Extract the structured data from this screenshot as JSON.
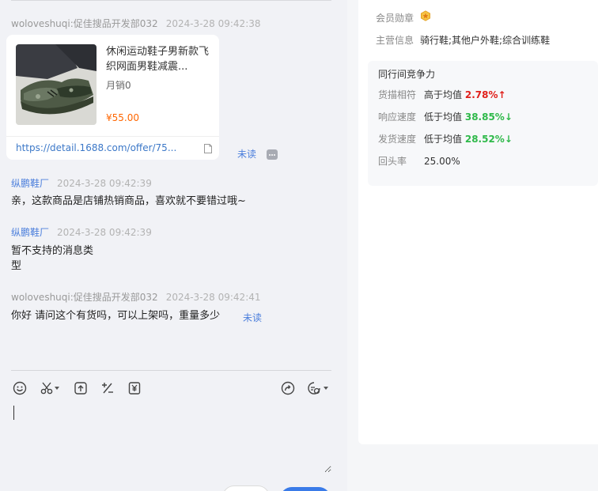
{
  "chat": {
    "messages": [
      {
        "sender": "woloveshuqi:促佳搜品开发部032",
        "time": "2024-3-28 09:42:38",
        "type": "product"
      },
      {
        "sender": "纵鹏鞋厂",
        "time": "2024-3-28 09:42:39",
        "text": "亲，这款商品是店铺热销商品，喜欢就不要错过哦~"
      },
      {
        "sender": "纵鹏鞋厂",
        "time": "2024-3-28 09:42:39",
        "text_line1": "暂不支持的消息类",
        "text_line2": "型"
      },
      {
        "sender": "woloveshuqi:促佳搜品开发部032",
        "time": "2024-3-28 09:42:41",
        "text": "你好 请问这个有货吗，可以上架吗，重量多少",
        "status": "未读"
      }
    ],
    "product_card": {
      "title": "休闲运动鞋子男新款飞织网面男鞋减震...",
      "sales": "月销0",
      "price": "¥55.00",
      "link": "https://detail.1688.com/offer/75...",
      "status": "未读"
    }
  },
  "toolbar": {
    "icons": [
      "emoji-icon",
      "scissors-icon",
      "upload-icon",
      "quick-phrase-icon",
      "coupon-icon",
      "share-icon",
      "settings-icon"
    ]
  },
  "seller_info": {
    "badge_label": "会员勋章",
    "main_business_label": "主营信息",
    "main_business_value": "骑行鞋;其他户外鞋;综合训练鞋"
  },
  "competition": {
    "title": "同行间竞争力",
    "rows": [
      {
        "label": "货描相符",
        "compare": "高于均值",
        "value": "2.78%",
        "arrow": "↑"
      },
      {
        "label": "响应速度",
        "compare": "低于均值",
        "value": "38.85%",
        "arrow": "↓"
      },
      {
        "label": "发货速度",
        "compare": "低于均值",
        "value": "28.52%",
        "arrow": "↓"
      },
      {
        "label": "回头率",
        "compare": "",
        "value": "25.00%",
        "arrow": ""
      }
    ]
  },
  "colors": {
    "link_blue": "#4c7fdc",
    "price_orange": "#ff6600",
    "higher_red": "#e0201b",
    "lower_green": "#2fb94a",
    "send_button_blue": "#3a7be8"
  }
}
